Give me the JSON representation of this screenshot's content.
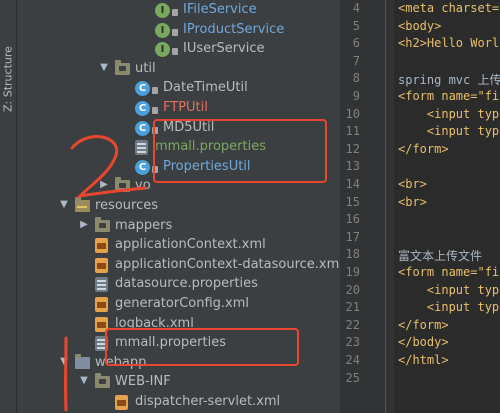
{
  "structure_panel": {
    "label": "Z: Structure"
  },
  "tree": [
    {
      "depth": 5,
      "kind": "interface",
      "label": "IFileService",
      "style": "blue",
      "expander": ""
    },
    {
      "depth": 5,
      "kind": "interface",
      "label": "IProductService",
      "style": "blue",
      "expander": ""
    },
    {
      "depth": 5,
      "kind": "interface",
      "label": "IUserService",
      "style": "normal",
      "expander": ""
    },
    {
      "depth": 3,
      "kind": "package",
      "label": "util",
      "style": "normal",
      "expander": "▼"
    },
    {
      "depth": 4,
      "kind": "class",
      "label": "DateTimeUtil",
      "style": "normal",
      "expander": ""
    },
    {
      "depth": 4,
      "kind": "class",
      "label": "FTPUtil",
      "style": "red",
      "expander": ""
    },
    {
      "depth": 4,
      "kind": "class",
      "label": "MD5Util",
      "style": "normal",
      "expander": ""
    },
    {
      "depth": 4,
      "kind": "props",
      "label": "mmall.properties",
      "style": "green",
      "expander": ""
    },
    {
      "depth": 4,
      "kind": "class",
      "label": "PropertiesUtil",
      "style": "blue",
      "expander": ""
    },
    {
      "depth": 3,
      "kind": "package",
      "label": "vo",
      "style": "normal",
      "expander": "▶"
    },
    {
      "depth": 1,
      "kind": "resfolder",
      "label": "resources",
      "style": "normal",
      "expander": "▼"
    },
    {
      "depth": 2,
      "kind": "package",
      "label": "mappers",
      "style": "normal",
      "expander": "▶"
    },
    {
      "depth": 2,
      "kind": "xml",
      "label": "applicationContext.xml",
      "style": "normal",
      "expander": ""
    },
    {
      "depth": 2,
      "kind": "xml",
      "label": "applicationContext-datasource.xml",
      "style": "normal",
      "expander": ""
    },
    {
      "depth": 2,
      "kind": "props",
      "label": "datasource.properties",
      "style": "normal",
      "expander": ""
    },
    {
      "depth": 2,
      "kind": "xml",
      "label": "generatorConfig.xml",
      "style": "normal",
      "expander": ""
    },
    {
      "depth": 2,
      "kind": "xml",
      "label": "logback.xml",
      "style": "normal",
      "expander": ""
    },
    {
      "depth": 2,
      "kind": "props",
      "label": "mmall.properties",
      "style": "normal",
      "expander": ""
    },
    {
      "depth": 1,
      "kind": "webfolder",
      "label": "webapp",
      "style": "normal",
      "expander": "▼"
    },
    {
      "depth": 2,
      "kind": "package",
      "label": "WEB-INF",
      "style": "normal",
      "expander": "▼"
    },
    {
      "depth": 3,
      "kind": "xml",
      "label": "dispatcher-servlet.xml",
      "style": "normal",
      "expander": ""
    }
  ],
  "line_numbers": [
    "4",
    "5",
    "6",
    "7",
    "8",
    "9",
    "10",
    "11",
    "12",
    "13",
    "14",
    "15",
    "16",
    "17",
    "18",
    "19",
    "20",
    "21",
    "22",
    "23",
    "24",
    "25"
  ],
  "code_lines": [
    "<meta charset=",
    "<body>",
    "<h2>Hello Worl",
    "",
    "spring mvc 上传",
    "<form name=\"fi",
    "    <input typ",
    "    <input typ",
    "</form>",
    "",
    "<br>",
    "<br>",
    "",
    "",
    "富文本上传文件",
    "<form name=\"fi",
    "    <input typ",
    "    <input typ",
    "</form>",
    "</body>",
    "</html>",
    ""
  ],
  "colors": {
    "annotation": "#e8472f"
  }
}
